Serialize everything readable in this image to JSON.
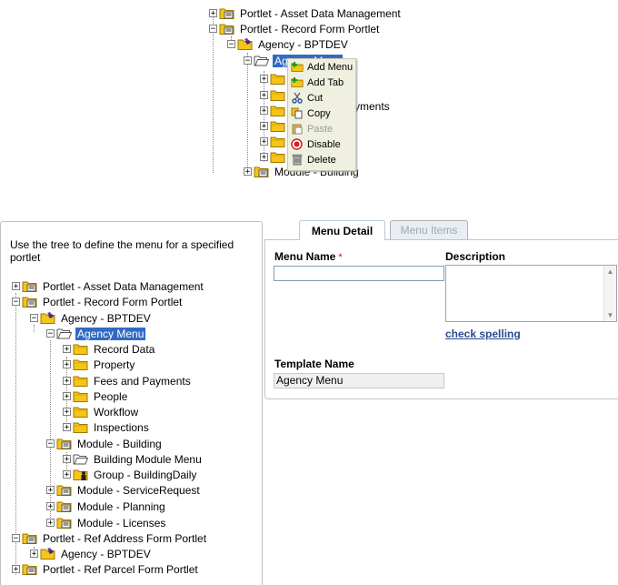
{
  "top_tree": {
    "nodes": [
      {
        "label": "Portlet - Asset Data Management"
      },
      {
        "label": "Portlet - Record Form Portlet"
      },
      {
        "label": "Agency - BPTDEV"
      },
      {
        "label": "Agency Menu"
      },
      {
        "label": "yments"
      },
      {
        "label": "Module - Building"
      }
    ]
  },
  "context_menu": {
    "items": [
      {
        "label": "Add Menu",
        "icon": "add-menu-icon",
        "enabled": true
      },
      {
        "label": "Add Tab",
        "icon": "add-tab-icon",
        "enabled": true
      },
      {
        "label": "Cut",
        "icon": "scissors-icon",
        "enabled": true
      },
      {
        "label": "Copy",
        "icon": "copy-icon",
        "enabled": true
      },
      {
        "label": "Paste",
        "icon": "paste-icon",
        "enabled": false
      },
      {
        "label": "Disable",
        "icon": "disable-icon",
        "enabled": true
      },
      {
        "label": "Delete",
        "icon": "trash-icon",
        "enabled": true
      }
    ]
  },
  "left_panel": {
    "intro": "Use the tree to define the menu for a specified portlet",
    "tree": [
      {
        "label": "Portlet - Asset Data Management"
      },
      {
        "label": "Portlet - Record Form Portlet"
      },
      {
        "label": "Agency - BPTDEV"
      },
      {
        "label": "Agency Menu"
      },
      {
        "label": "Record Data"
      },
      {
        "label": "Property"
      },
      {
        "label": "Fees and Payments"
      },
      {
        "label": "People"
      },
      {
        "label": "Workflow"
      },
      {
        "label": "Inspections"
      },
      {
        "label": "Module - Building"
      },
      {
        "label": "Building Module Menu"
      },
      {
        "label": "Group - BuildingDaily"
      },
      {
        "label": "Module - ServiceRequest"
      },
      {
        "label": "Module - Planning"
      },
      {
        "label": "Module - Licenses"
      },
      {
        "label": "Portlet - Ref Address Form Portlet"
      },
      {
        "label": "Agency - BPTDEV"
      },
      {
        "label": "Portlet - Ref Parcel Form Portlet"
      }
    ]
  },
  "tabs": [
    {
      "label": "Menu Detail",
      "active": true
    },
    {
      "label": "Menu Items",
      "active": false
    }
  ],
  "form": {
    "menu_name_label": "Menu Name",
    "required_mark": "*",
    "menu_name_value": "",
    "description_label": "Description",
    "check_spelling": "check spelling",
    "template_name_label": "Template Name",
    "template_name_value": "Agency Menu"
  },
  "colors": {
    "selection": "#316ac5",
    "link": "#2a4a8a",
    "folder": "#f5c518"
  }
}
